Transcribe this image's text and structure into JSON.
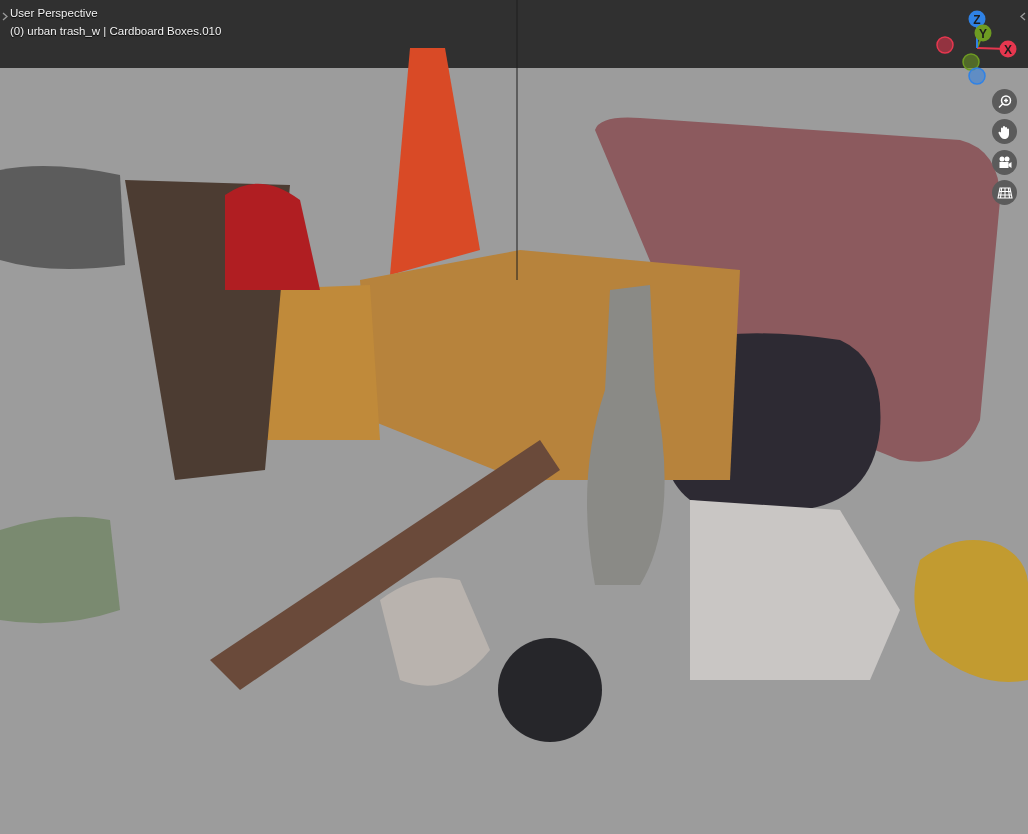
{
  "viewport": {
    "mode": "User Perspective",
    "object_info": "(0) urban trash_w | Cardboard Boxes.010"
  },
  "gizmo": [
    {
      "kind": "positive",
      "label": "Z",
      "color": "#2f82e6"
    },
    {
      "kind": "positive",
      "label": "Y",
      "color": "#6e9b22"
    },
    {
      "kind": "positive",
      "label": "X",
      "color": "#e6374f"
    },
    {
      "kind": "negative",
      "color": "#e6374f"
    },
    {
      "kind": "negative",
      "color": "#6e9b22"
    },
    {
      "kind": "negative",
      "color": "#2f82e6"
    }
  ],
  "nav_buttons": [
    {
      "kind": "zoom"
    },
    {
      "kind": "pan"
    },
    {
      "kind": "camera"
    },
    {
      "kind": "grid"
    }
  ]
}
